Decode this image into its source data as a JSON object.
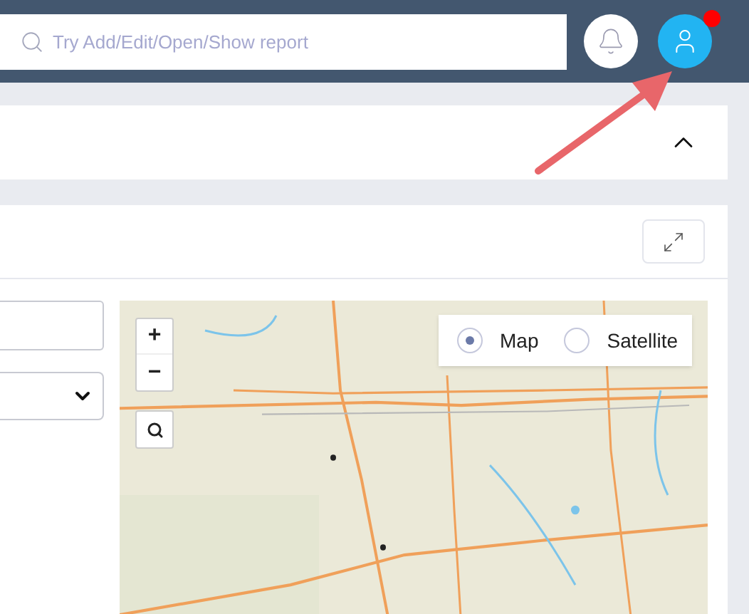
{
  "header": {
    "search": {
      "placeholder": "Try Add/Edit/Open/Show report"
    },
    "profile_notification": true
  },
  "map": {
    "zoom_buttons": [
      "+",
      "−"
    ],
    "map_types": [
      {
        "label": "Map",
        "selected": true
      },
      {
        "label": "Satellite",
        "selected": false
      }
    ]
  }
}
